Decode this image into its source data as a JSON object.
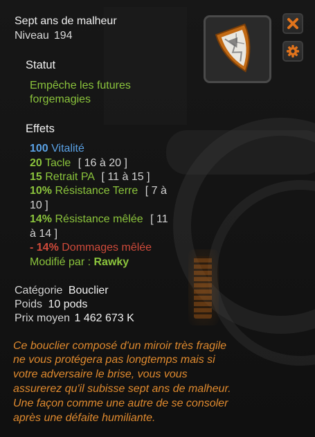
{
  "item": {
    "name": "Sept ans de malheur",
    "level_label": "Niveau",
    "level_value": "194"
  },
  "status": {
    "heading": "Statut",
    "line1": "Empêche les futures",
    "line2": "forgemagies"
  },
  "effects": {
    "heading": "Effets",
    "rows": [
      {
        "value": "100",
        "label": "Vitalité",
        "range": ""
      },
      {
        "value": "20",
        "label": "Tacle",
        "range": "[ 16 à 20 ]"
      },
      {
        "value": "15",
        "label": "Retrait PA",
        "range": "[ 11 à 15 ]"
      },
      {
        "value": "10%",
        "label": "Résistance Terre",
        "range": "[ 7 à",
        "range_cont": "10 ]"
      },
      {
        "value": "14%",
        "label": "Résistance mêlée",
        "range": "[ 11",
        "range_cont": "à 14 ]"
      },
      {
        "value": "- 14%",
        "label": "Dommages mêlée",
        "range": ""
      }
    ],
    "modified_label": "Modifié par :",
    "modified_by": "Rawky"
  },
  "info": {
    "category_label": "Catégorie",
    "category_value": "Bouclier",
    "weight_label": "Poids",
    "weight_value": "10 pods",
    "price_label": "Prix moyen",
    "price_value": "1 462 673 K"
  },
  "description": [
    "Ce bouclier composé d'un miroir très fragile",
    "ne vous protégera pas longtemps mais si",
    "votre adversaire le brise, vous vous",
    "assurerez qu'il subisse sept ans de malheur.",
    "Une façon comme une autre de se consoler",
    "après une défaite humiliante."
  ],
  "icons": {
    "item": "broken-mirror-shield-icon",
    "close": "close-icon",
    "settings": "gear-icon"
  },
  "colors": {
    "effect_green": "#8bc43c",
    "vitality_blue": "#5aa2e6",
    "malus_red": "#cf4a3a",
    "description_orange": "#e08a2e",
    "button_orange": "#e0731c"
  }
}
